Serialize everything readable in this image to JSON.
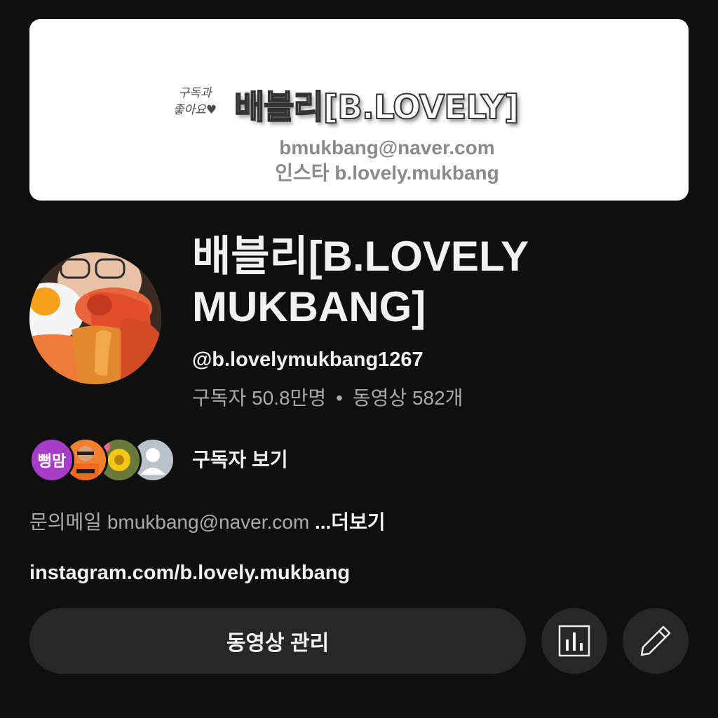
{
  "banner": {
    "handwriting": "구독과 좋아요♥",
    "title": "배블리[B.LOVELY]",
    "email": "bmukbang@naver.com",
    "instagram": "인스타 b.lovely.mukbang"
  },
  "channel": {
    "name": "배블리[B.LOVELY MUKBANG]",
    "handle": "@b.lovelymukbang1267",
    "subscribers": "구독자 50.8만명",
    "separator": "•",
    "videos": "동영상 582개"
  },
  "subscribers_preview": {
    "first_avatar_text": "뻥맘",
    "label": "구독자 보기"
  },
  "description": {
    "text": "문의메일 bmukbang@naver.com ",
    "more": "...더보기"
  },
  "link": "instagram.com/b.lovely.mukbang",
  "actions": {
    "manage_videos": "동영상 관리",
    "analytics_icon": "analytics-bar-chart-icon",
    "edit_icon": "pencil-icon"
  },
  "colors": {
    "background": "#0f0f0f",
    "button": "#272727",
    "text": "#f1f1f1",
    "secondary_text": "#aaaaaa"
  }
}
